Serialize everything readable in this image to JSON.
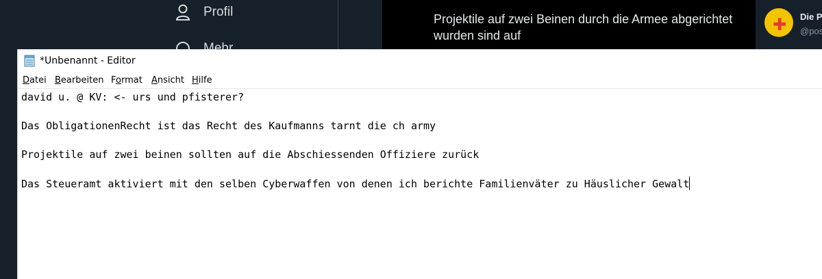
{
  "background_app": {
    "nav": {
      "profile_label": "Profil",
      "more_label": "Mehr"
    },
    "tooltip_text": "Projektile auf zwei Beinen durch die Armee abgerichtet wurden sind auf",
    "user": {
      "name": "Die P",
      "handle": "@pos"
    }
  },
  "notepad": {
    "title": "*Unbenannt - Editor",
    "menu": [
      {
        "pre": "",
        "ul": "D",
        "post": "atei"
      },
      {
        "pre": "",
        "ul": "B",
        "post": "earbeiten"
      },
      {
        "pre": "F",
        "ul": "o",
        "post": "rmat"
      },
      {
        "pre": "",
        "ul": "A",
        "post": "nsicht"
      },
      {
        "pre": "",
        "ul": "H",
        "post": "ilfe"
      }
    ],
    "lines": [
      "david u. @ KV: <- urs und pfisterer?",
      "Das ObligationenRecht ist das Recht des Kaufmanns tarnt die ch army",
      "Projektile auf zwei beinen sollten auf die Abschiessenden Offiziere zurück",
      "Das Steueramt aktiviert mit den selben Cyberwaffen von denen ich berichte Familienväter zu Häuslicher Gewalt"
    ]
  },
  "colors": {
    "twitter_bg": "#15202b",
    "tooltip_bg": "#000000",
    "avatar_yellow": "#f3c400",
    "avatar_red": "#e53935",
    "editor_bg": "#ffffff"
  }
}
